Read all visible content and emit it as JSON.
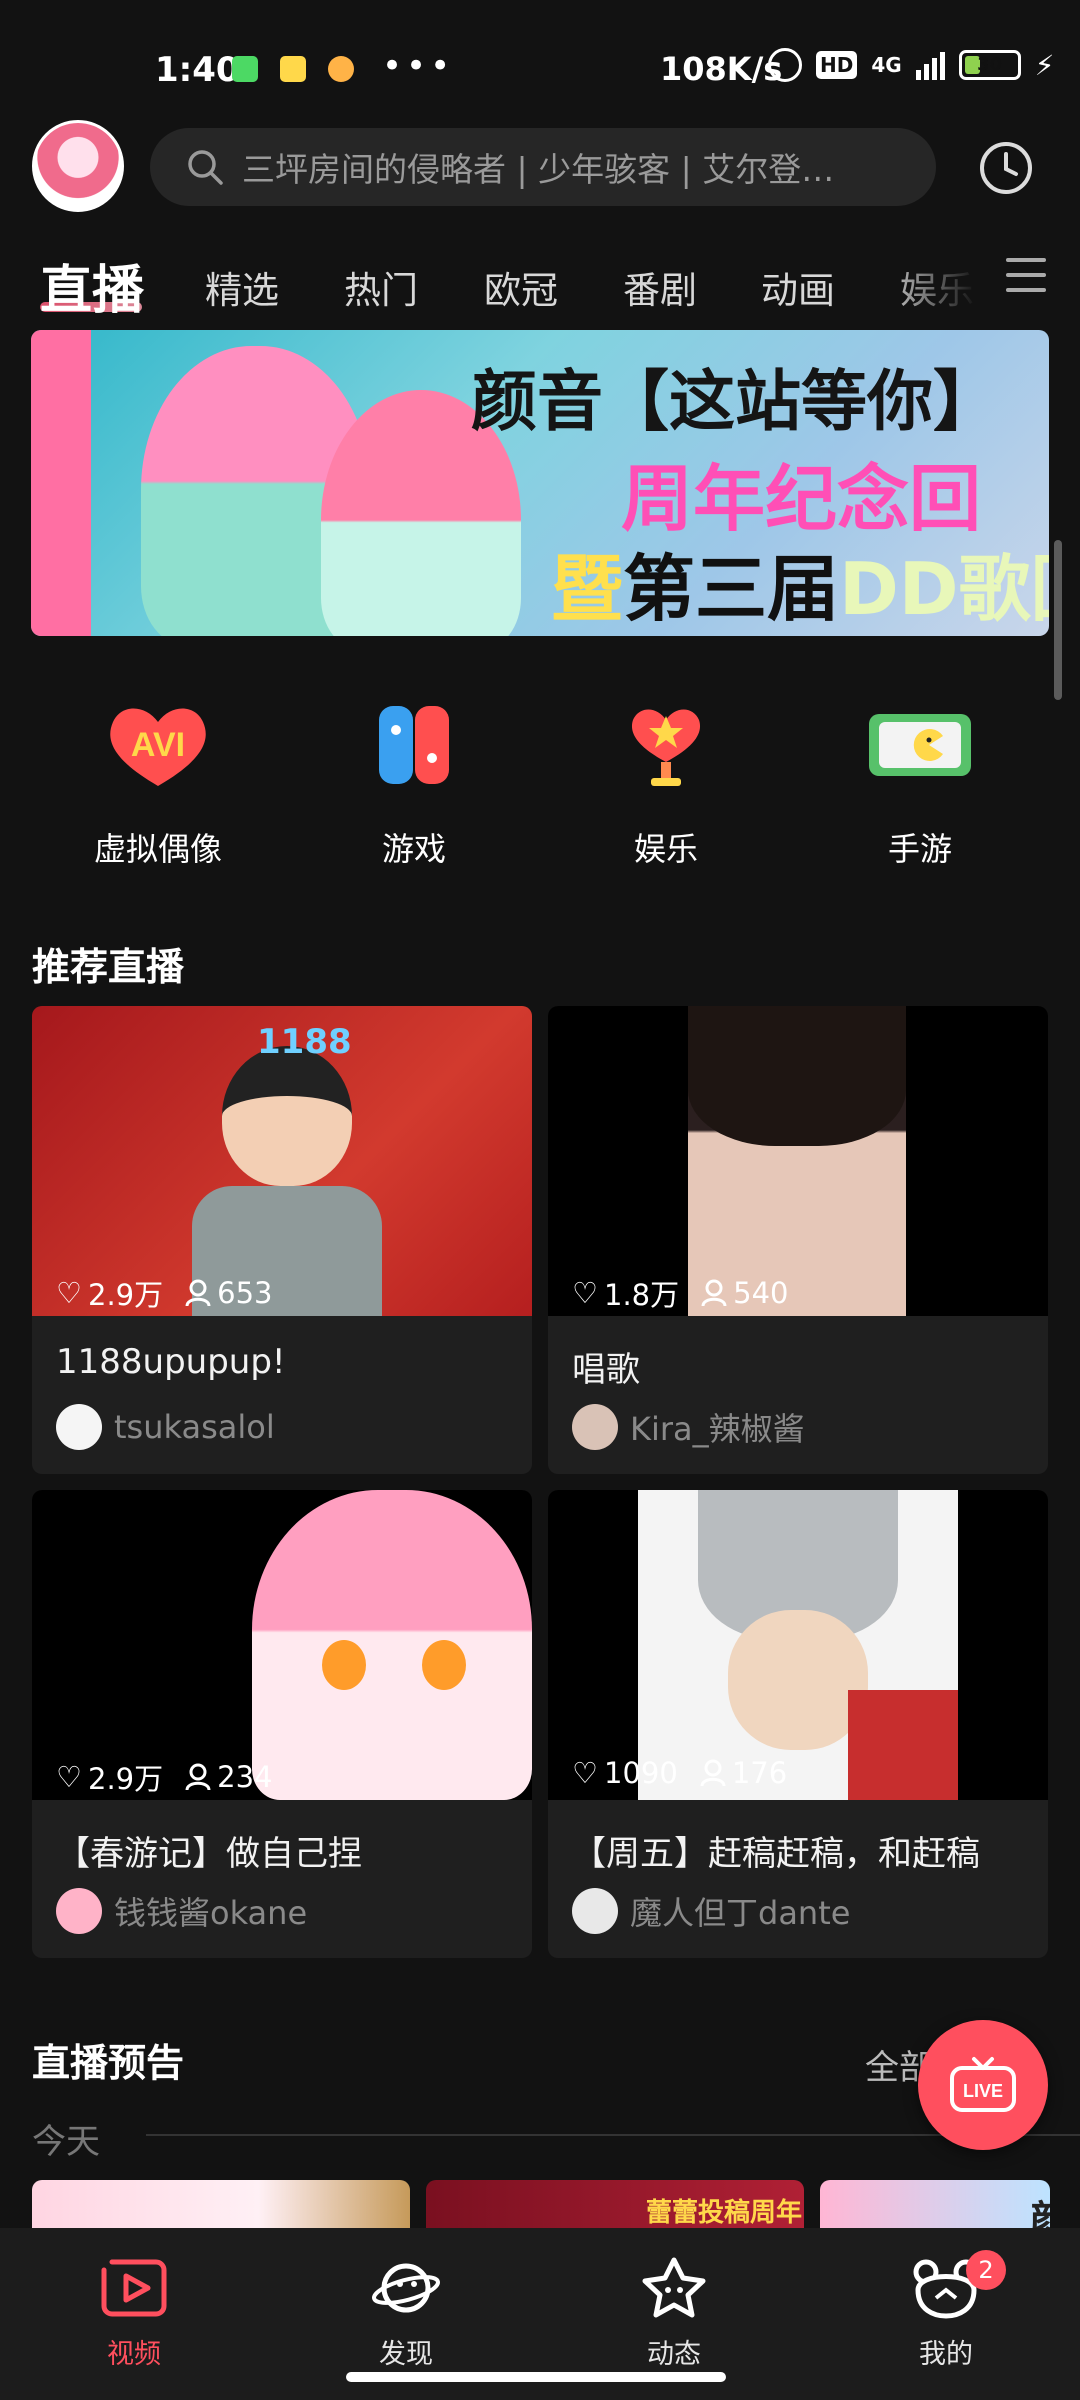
{
  "status_bar": {
    "time": "1:40",
    "dots": "•••",
    "net_speed": "108K/s",
    "hd": "HD",
    "network": "4G",
    "battery": "30",
    "battery_level": 0.3
  },
  "header": {
    "search_placeholder": "三坪房间的侵略者 | 少年骇客 | 艾尔登…",
    "icons": [
      "avatar",
      "search-icon",
      "history-icon"
    ]
  },
  "tabs": [
    {
      "label": "直播",
      "active": true
    },
    {
      "label": "精选"
    },
    {
      "label": "热门"
    },
    {
      "label": "欧冠"
    },
    {
      "label": "番剧"
    },
    {
      "label": "动画"
    },
    {
      "label": "娱乐"
    }
  ],
  "banner": {
    "line1": "颜音【这站等你】",
    "line2": "周年纪念回",
    "line3_a": "暨",
    "line3_b": "第三届",
    "line3_c": "DD歌回"
  },
  "categories": [
    {
      "label": "虚拟偶像",
      "icon": "avi-icon",
      "icon_text": "AVI"
    },
    {
      "label": "游戏",
      "icon": "game-controller-icon"
    },
    {
      "label": "娱乐",
      "icon": "trophy-heart-icon"
    },
    {
      "label": "手游",
      "icon": "mobile-game-icon"
    }
  ],
  "recommended": {
    "title": "推荐直播",
    "cards": [
      {
        "likes": "2.9万",
        "viewers": "653",
        "title": "1188upupup!",
        "owner": "tsukasalol",
        "thumb_text": "1188"
      },
      {
        "likes": "1.8万",
        "viewers": "540",
        "title": "唱歌",
        "owner": "Kira_辣椒酱"
      },
      {
        "likes": "2.9万",
        "viewers": "234",
        "title": "【春游记】做自己捏",
        "owner": "钱钱酱okane"
      },
      {
        "likes": "1090",
        "viewers": "176",
        "title": "【周五】赶稿赶稿，和赶稿",
        "owner": "魔人但丁dante"
      }
    ]
  },
  "preview": {
    "title": "直播预告",
    "all_label": "全部",
    "today_label": "今天",
    "thumb2_text": "蕾蕾投稿周年",
    "thumb3_text": "颜"
  },
  "live_button": {
    "label": "LIVE"
  },
  "bottom_nav": [
    {
      "label": "视频",
      "icon": "video-play-icon",
      "active": true
    },
    {
      "label": "发现",
      "icon": "planet-icon"
    },
    {
      "label": "动态",
      "icon": "star-face-icon"
    },
    {
      "label": "我的",
      "icon": "bear-face-icon",
      "badge": "2"
    }
  ],
  "colors": {
    "accent": "#ff4f5e",
    "background": "#121212",
    "card": "#1f1f1f"
  }
}
